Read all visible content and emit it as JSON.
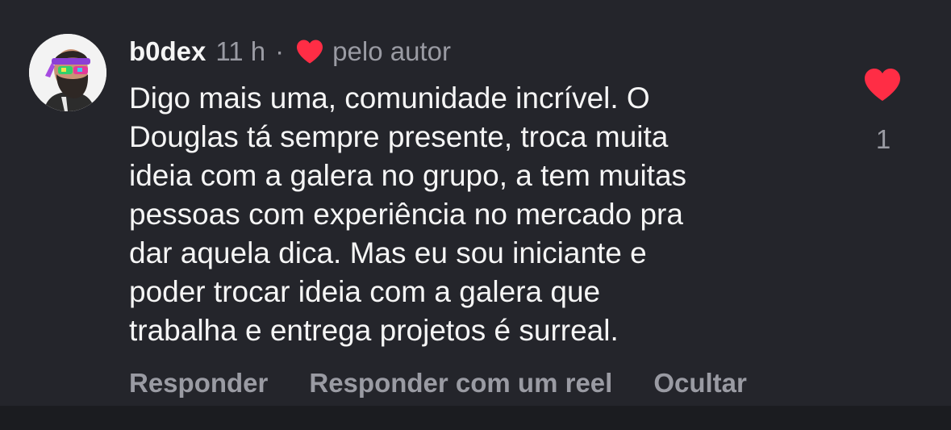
{
  "comment": {
    "username": "b0dex",
    "time": "11 h",
    "separator": "·",
    "author_badge": "pelo autor",
    "text": "Digo mais uma, comunidade incrível. O\nDouglas tá sempre presente, troca muita\nideia com a galera no grupo, a tem muitas\npessoas com experiência no mercado pra\ndar aquela dica. Mas eu sou iniciante e\npoder trocar ideia com a galera que\ntrabalha e entrega projetos é surreal.",
    "likes": "1"
  },
  "actions": {
    "reply": "Responder",
    "reply_reel": "Responder com um reel",
    "hide": "Ocultar"
  },
  "icons": {
    "author_heart": "heart-icon",
    "like": "heart-icon"
  },
  "colors": {
    "background": "#24252b",
    "text": "#f5f5f5",
    "muted": "#9a9ba3",
    "heart": "#ff2d45"
  }
}
